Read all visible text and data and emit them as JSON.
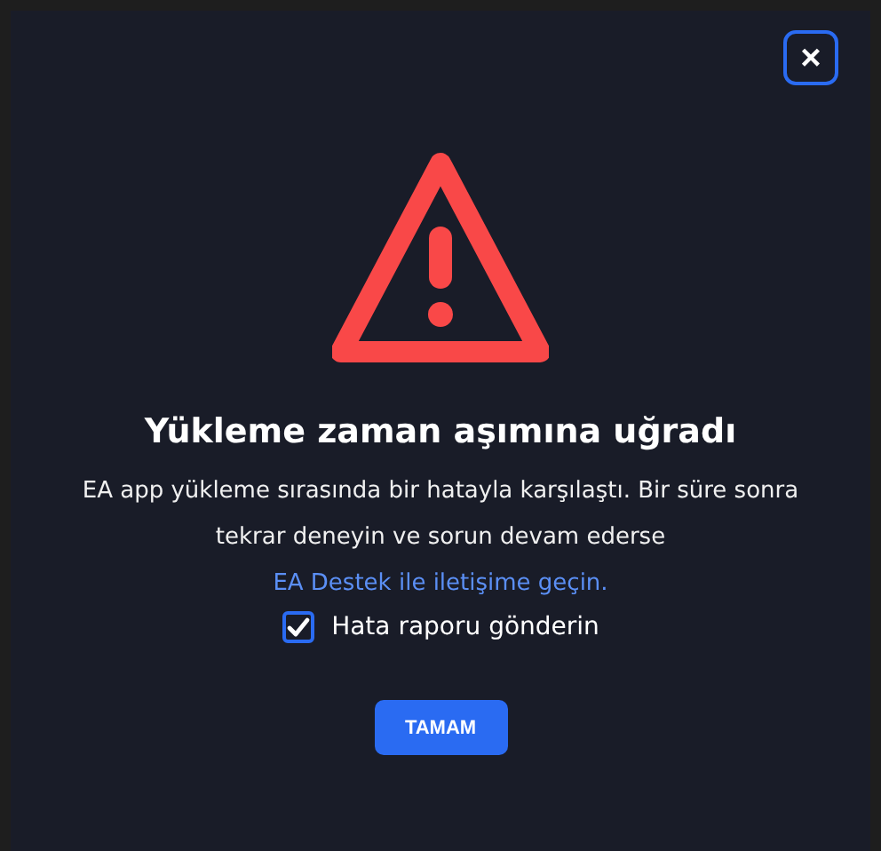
{
  "dialog": {
    "close_label": "×",
    "title": "Yükleme zaman aşımına uğradı",
    "message": "EA app yükleme sırasında bir hatayla karşılaştı. Bir süre sonra tekrar deneyin ve sorun devam ederse",
    "link": "EA Destek ile iletişime geçin.",
    "checkbox": {
      "label": "Hata raporu gönderin",
      "checked": true
    },
    "button": "TAMAM"
  }
}
